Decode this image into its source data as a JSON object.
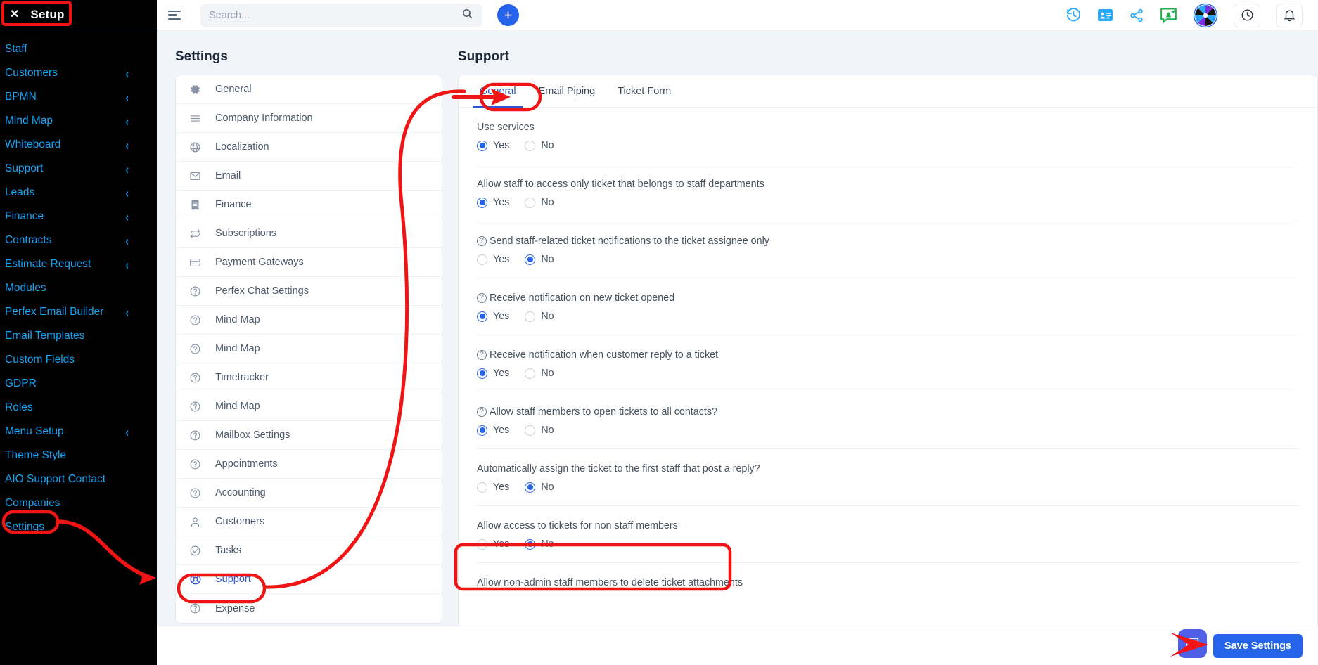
{
  "colors": {
    "accent": "#2563eb",
    "sidebar_bg": "#000000",
    "sidebar_link": "#15a3f5",
    "annotation": "#f01414",
    "panel_bg": "#f1f4f9",
    "active_link": "#2f55d4"
  },
  "sidebar": {
    "close_icon": "close-icon",
    "title": "Setup",
    "items": [
      {
        "label": "Staff",
        "chevron": false
      },
      {
        "label": "Customers",
        "chevron": true
      },
      {
        "label": "BPMN",
        "chevron": true
      },
      {
        "label": "Mind Map",
        "chevron": true
      },
      {
        "label": "Whiteboard",
        "chevron": true
      },
      {
        "label": "Support",
        "chevron": true
      },
      {
        "label": "Leads",
        "chevron": true
      },
      {
        "label": "Finance",
        "chevron": true
      },
      {
        "label": "Contracts",
        "chevron": true
      },
      {
        "label": "Estimate Request",
        "chevron": true
      },
      {
        "label": "Modules",
        "chevron": false
      },
      {
        "label": "Perfex Email Builder",
        "chevron": true
      },
      {
        "label": "Email Templates",
        "chevron": false
      },
      {
        "label": "Custom Fields",
        "chevron": false
      },
      {
        "label": "GDPR",
        "chevron": false
      },
      {
        "label": "Roles",
        "chevron": false
      },
      {
        "label": "Menu Setup",
        "chevron": true
      },
      {
        "label": "Theme Style",
        "chevron": false
      },
      {
        "label": "AIO Support Contact",
        "chevron": false
      },
      {
        "label": "Companies",
        "chevron": false
      },
      {
        "label": "Settings",
        "chevron": false
      }
    ],
    "chevron_glyph": "‹"
  },
  "topbar": {
    "menu_icon": "hamburger-menu-icon",
    "search": {
      "value": "",
      "placeholder": "Search..."
    },
    "search_icon": "search-icon",
    "add_label": "+",
    "right_icons": [
      "history-clock-icon",
      "contact-card-icon",
      "share-icon",
      "chat-message-icon",
      "pinwheel-logo-icon",
      "time-clock-icon",
      "notification-bell-icon"
    ]
  },
  "settings_panel": {
    "title": "Settings",
    "items": [
      {
        "label": "General",
        "icon": "gear-icon",
        "active": false
      },
      {
        "label": "Company Information",
        "icon": "list-lines-icon",
        "active": false
      },
      {
        "label": "Localization",
        "icon": "globe-icon",
        "active": false
      },
      {
        "label": "Email",
        "icon": "envelope-icon",
        "active": false
      },
      {
        "label": "Finance",
        "icon": "receipt-icon",
        "active": false
      },
      {
        "label": "Subscriptions",
        "icon": "refresh-cycle-icon",
        "active": false
      },
      {
        "label": "Payment Gateways",
        "icon": "credit-card-icon",
        "active": false
      },
      {
        "label": "Perfex Chat Settings",
        "icon": "question-circle-icon",
        "active": false
      },
      {
        "label": "Mind Map",
        "icon": "question-circle-icon",
        "active": false
      },
      {
        "label": "Mind Map",
        "icon": "question-circle-icon",
        "active": false
      },
      {
        "label": "Timetracker",
        "icon": "question-circle-icon",
        "active": false
      },
      {
        "label": "Mind Map",
        "icon": "question-circle-icon",
        "active": false
      },
      {
        "label": "Mailbox Settings",
        "icon": "question-circle-icon",
        "active": false
      },
      {
        "label": "Appointments",
        "icon": "question-circle-icon",
        "active": false
      },
      {
        "label": "Accounting",
        "icon": "question-circle-icon",
        "active": false
      },
      {
        "label": "Customers",
        "icon": "user-icon",
        "active": false
      },
      {
        "label": "Tasks",
        "icon": "check-circle-icon",
        "active": false
      },
      {
        "label": "Support",
        "icon": "lifebuoy-icon",
        "active": true
      },
      {
        "label": "Expense",
        "icon": "question-circle-icon",
        "active": false
      }
    ]
  },
  "support_panel": {
    "title": "Support",
    "tabs": [
      {
        "label": "General",
        "active": true
      },
      {
        "label": "Email Piping",
        "active": false
      },
      {
        "label": "Ticket Form",
        "active": false
      }
    ],
    "yes_label": "Yes",
    "no_label": "No",
    "fields": [
      {
        "label": "Use services",
        "help": false,
        "value": "Yes"
      },
      {
        "label": "Allow staff to access only ticket that belongs to staff departments",
        "help": false,
        "value": "Yes"
      },
      {
        "label": "Send staff-related ticket notifications to the ticket assignee only",
        "help": true,
        "value": "No"
      },
      {
        "label": "Receive notification on new ticket opened",
        "help": true,
        "value": "Yes"
      },
      {
        "label": "Receive notification when customer reply to a ticket",
        "help": true,
        "value": "Yes"
      },
      {
        "label": "Allow staff members to open tickets to all contacts?",
        "help": true,
        "value": "Yes"
      },
      {
        "label": "Automatically assign the ticket to the first staff that post a reply?",
        "help": false,
        "value": "No"
      },
      {
        "label": "Allow access to tickets for non staff members",
        "help": false,
        "value": "No"
      },
      {
        "label": "Allow non-admin staff members to delete ticket attachments",
        "help": false,
        "value": null
      }
    ]
  },
  "footer": {
    "chat_icon": "chat-bubble-icon",
    "save_label": "Save Settings"
  }
}
